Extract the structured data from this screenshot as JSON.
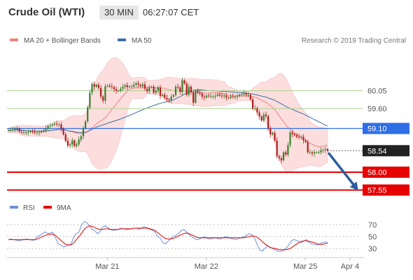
{
  "header": {
    "title": "Crude Oil (WTI)",
    "timeframe": "30 MIN",
    "time": "06:27:07 CET"
  },
  "legend": {
    "ma20": "MA 20 + Bollinger Bands",
    "ma50": "MA 50",
    "credit": "Research © 2019 Trading Central"
  },
  "rsi_legend": {
    "rsi": "RSI",
    "ma9": "9MA"
  },
  "colors": {
    "price_up": "#3a7d2c",
    "price_down": "#b01e1e",
    "ma20": "#f08080",
    "band_fill": "#fcdede",
    "ma50": "#3d6fa3",
    "resistance": "#a9d18e",
    "pivot": "#2f6fe5",
    "support": "#e60000",
    "rsi": "#6c8fdc",
    "rsi_ma": "#e60000"
  },
  "chart_data": [
    {
      "type": "candlestick",
      "title": "Crude Oil (WTI)",
      "ylim": [
        57.4,
        61.1
      ],
      "x_ticks": [
        "Mar 21",
        "Mar 22",
        "Mar 25",
        "Apr 4"
      ],
      "series": [
        {
          "name": "Price",
          "values": [
            59.05,
            59.06,
            59.07,
            59.09,
            59.1,
            59.02,
            59.0,
            59.0,
            59.0,
            59.01,
            59.03,
            59.01,
            59.0,
            59.0,
            59.0,
            59.03,
            59.05,
            59.1,
            59.16,
            59.17,
            59.2,
            59.22,
            59.2,
            59.2,
            59.1,
            58.95,
            58.79,
            58.67,
            58.7,
            58.8,
            58.66,
            58.7,
            58.82,
            58.9,
            59.1,
            59.28,
            59.63,
            60.0,
            60.22,
            60.15,
            60.2,
            60.12,
            59.9,
            59.8,
            60.16,
            60.18,
            60.16,
            60.14,
            60.09,
            60.05,
            60.05,
            60.1,
            60.15,
            60.19,
            60.14,
            60.16,
            60.16,
            60.2,
            60.24,
            60.2,
            60.16,
            60.21,
            60.1,
            60.04,
            60.13,
            60.15,
            60.0,
            60.05,
            60.13,
            59.92,
            59.95,
            59.87,
            59.83,
            59.81,
            59.9,
            59.94,
            60.15,
            60.13,
            60.02,
            60.31,
            60.23,
            59.95,
            60.15,
            60.01,
            59.75,
            60.05,
            60.0,
            59.98,
            59.9,
            59.88,
            59.93,
            59.91,
            59.91,
            59.91,
            59.92,
            59.96,
            59.93,
            59.91,
            59.93,
            59.88,
            59.87,
            59.91,
            59.9,
            59.9,
            59.91,
            59.95,
            59.96,
            59.99,
            59.95,
            59.95,
            59.83,
            59.6,
            59.61,
            59.5,
            59.4,
            59.3,
            59.45,
            59.41,
            59.1,
            58.95,
            58.99,
            58.8,
            58.4,
            58.35,
            58.3,
            58.5,
            58.44,
            58.68,
            59.0,
            58.96,
            58.93,
            58.89,
            58.88,
            58.89,
            58.8,
            58.76,
            58.5,
            58.5,
            58.47,
            58.5,
            58.5,
            58.5,
            58.55,
            58.56,
            58.58,
            58.54
          ]
        }
      ],
      "support_resistance": [
        {
          "label": "60.05",
          "value": 60.05,
          "kind": "resistance"
        },
        {
          "label": "59.60",
          "value": 59.6,
          "kind": "resistance"
        },
        {
          "label": "59.10",
          "value": 59.1,
          "kind": "pivot"
        },
        {
          "label": "58.54",
          "value": 58.54,
          "kind": "last_price"
        },
        {
          "label": "58.00",
          "value": 58.0,
          "kind": "support"
        },
        {
          "label": "57.55",
          "value": 57.55,
          "kind": "support"
        }
      ],
      "indicators": [
        "MA 20 + Bollinger Bands",
        "MA 50"
      ],
      "projection": {
        "from": 58.54,
        "to": 57.55
      }
    },
    {
      "type": "line",
      "title": "RSI",
      "ylim": [
        15,
        85
      ],
      "y_ticks": [
        70,
        50,
        30
      ],
      "series": [
        {
          "name": "RSI",
          "values": [
            45,
            46,
            45,
            44,
            43,
            44,
            45,
            46,
            45,
            44,
            44,
            50,
            52,
            55,
            58,
            55,
            56,
            57,
            48,
            38,
            36,
            33,
            34,
            36,
            38,
            50,
            55,
            58,
            70,
            75,
            73,
            68,
            62,
            60,
            55,
            58,
            66,
            68,
            65,
            62,
            60,
            61,
            62,
            64,
            63,
            62,
            62,
            63,
            64,
            64,
            62,
            65,
            66,
            65,
            62,
            61,
            58,
            50,
            48,
            40,
            38,
            42,
            47,
            50,
            52,
            55,
            60,
            62,
            58,
            54,
            50,
            47,
            45,
            46,
            48,
            50,
            47,
            46,
            47,
            48,
            47,
            46,
            48,
            50,
            49,
            47,
            46,
            45,
            47,
            48,
            50,
            52,
            55,
            53,
            48,
            38,
            28,
            26,
            30,
            35,
            32,
            30,
            28,
            26,
            25,
            27,
            30,
            35,
            42,
            45,
            44,
            42,
            40,
            43,
            45,
            40,
            38,
            37,
            36,
            38,
            40,
            41,
            40
          ]
        },
        {
          "name": "9MA",
          "values": [
            45,
            45,
            45,
            45,
            45,
            45,
            45,
            45,
            45,
            45,
            45,
            46,
            48,
            50,
            52,
            53,
            54,
            54,
            52,
            48,
            44,
            40,
            37,
            36,
            36,
            40,
            45,
            50,
            56,
            62,
            66,
            68,
            67,
            65,
            63,
            62,
            62,
            63,
            63,
            62,
            62,
            62,
            62,
            63,
            63,
            63,
            63,
            63,
            64,
            64,
            64,
            64,
            64,
            64,
            63,
            62,
            60,
            57,
            53,
            50,
            47,
            46,
            46,
            47,
            49,
            51,
            53,
            55,
            56,
            55,
            53,
            51,
            49,
            48,
            48,
            48,
            48,
            48,
            48,
            48,
            48,
            48,
            48,
            48,
            48,
            48,
            48,
            48,
            48,
            48,
            48,
            49,
            50,
            51,
            51,
            49,
            46,
            42,
            38,
            35,
            32,
            31,
            30,
            29,
            28,
            28,
            28,
            29,
            31,
            34,
            37,
            40,
            42,
            43,
            43,
            42,
            41,
            40,
            38,
            37,
            37,
            38,
            39
          ]
        }
      ]
    }
  ]
}
